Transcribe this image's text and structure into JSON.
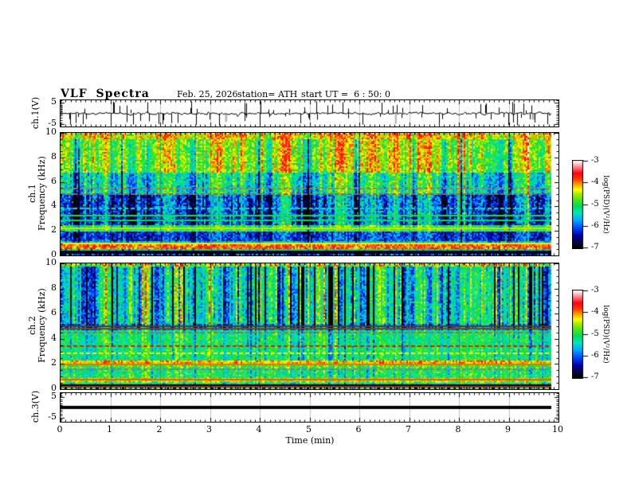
{
  "header": {
    "title": "VLF Spectra",
    "date": "Feb. 25, 2026",
    "station": "station= ATH",
    "start_ut": "start UT =  6 : 50: 0"
  },
  "chart_data": {
    "type": "heatmap",
    "description": "VLF receiver summary plot: ch.1 voltage waveform, ch.1 and ch.2 spectrograms (0-10 kHz, log PSD color coded), ch.3 flat voltage trace, versus time in minutes.",
    "xaxis": {
      "label": "Time (min)",
      "range": [
        0,
        10
      ],
      "ticks": [
        0,
        1,
        2,
        3,
        4,
        5,
        6,
        7,
        8,
        9,
        10
      ],
      "minor_step": 0.1,
      "data_end_min": 9.85
    },
    "colormap": {
      "range": [
        -7,
        -3
      ],
      "stops": [
        {
          "t": 0.0,
          "c": "#000000"
        },
        {
          "t": 0.06,
          "c": "#06063a"
        },
        {
          "t": 0.14,
          "c": "#0000aa"
        },
        {
          "t": 0.23,
          "c": "#0046ff"
        },
        {
          "t": 0.32,
          "c": "#00aaff"
        },
        {
          "t": 0.4,
          "c": "#00e6be"
        },
        {
          "t": 0.48,
          "c": "#00dc5a"
        },
        {
          "t": 0.55,
          "c": "#46e614"
        },
        {
          "t": 0.62,
          "c": "#aaeb00"
        },
        {
          "t": 0.67,
          "c": "#ffff00"
        },
        {
          "t": 0.73,
          "c": "#ffa000"
        },
        {
          "t": 0.79,
          "c": "#ff3c00"
        },
        {
          "t": 0.86,
          "c": "#ff0014"
        },
        {
          "t": 0.92,
          "c": "#ff6e78"
        },
        {
          "t": 0.97,
          "c": "#ffc8cd"
        },
        {
          "t": 1.0,
          "c": "#ffffff"
        }
      ]
    },
    "colorbars": [
      {
        "label": "log(PSD)(V²/Hz)",
        "ticks": [
          -3,
          -4,
          -5,
          -6,
          -7
        ]
      },
      {
        "label": "log(PSD)(V²/Hz)",
        "ticks": [
          -3,
          -4,
          -5,
          -6,
          -7
        ]
      }
    ],
    "panels": [
      {
        "id": "ch1_wave",
        "type": "line",
        "ylabel": "ch.1(V)",
        "ylim": [
          -6,
          6
        ],
        "yticks": [
          5,
          -5
        ],
        "y_minor_step": 1,
        "signal": {
          "seed": 11,
          "baseline": 0,
          "noise_amp": 0.4,
          "spikes": {
            "count": 85,
            "amp_min": 1.2,
            "amp_max": 5.6,
            "down_bias": 0.55
          },
          "gray_dips": 3
        }
      },
      {
        "id": "ch1_spec",
        "type": "heatmap",
        "ylabel_lines": [
          "ch.1",
          "Frequency (kHz)"
        ],
        "ylim": [
          0,
          10
        ],
        "yticks": [
          0,
          2,
          4,
          6,
          8,
          10
        ],
        "y_minor_step": 0.5,
        "seed": 42,
        "streaks": {
          "smooth": 0.78,
          "sigma": 0.5,
          "dark_p": 0.05,
          "dark_amp": 1.6,
          "bright_p": 0.1,
          "bright_amp": 0.9
        },
        "bands": [
          {
            "f": [
              9.5,
              10.01
            ],
            "base": -4.25,
            "var": 0.5,
            "streak": 0.5
          },
          {
            "f": [
              6.8,
              9.5
            ],
            "base": -4.65,
            "var": 0.5,
            "streak": 0.85
          },
          {
            "f": [
              5.0,
              6.8
            ],
            "base": -5.35,
            "var": 0.55,
            "streak": 0.95
          },
          {
            "f": [
              2.45,
              5.0
            ],
            "base": -6.1,
            "var": 0.6,
            "streak": 1.05
          },
          {
            "f": [
              2.0,
              2.45
            ],
            "base": -5.0,
            "var": 0.5,
            "streak": 0.55
          },
          {
            "f": [
              1.15,
              2.0
            ],
            "base": -6.2,
            "var": 0.5,
            "streak": 0.45
          },
          {
            "f": [
              0.95,
              1.15
            ],
            "base": -5.6,
            "var": 0.5,
            "streak": 0.3
          },
          {
            "f": [
              0.5,
              0.95
            ],
            "base": -3.85,
            "var": 0.5,
            "streak": 0.2
          },
          {
            "f": [
              0.35,
              0.5
            ],
            "base": -5.6,
            "var": 0.6,
            "streak": 0.2
          },
          {
            "f": [
              0.12,
              0.35
            ],
            "base": -6.85,
            "var": 0.3,
            "streak": 0.05
          },
          {
            "f": [
              0.0,
              0.12
            ],
            "base": -6.3,
            "var": 0.9,
            "streak": 0.05
          }
        ],
        "hlines": [
          {
            "f": 5.5,
            "color": "#8c7c6e",
            "dash": true
          },
          {
            "f": 5.05,
            "color": "#96604b",
            "dash": true
          },
          {
            "f": 3.9,
            "value": -5.4,
            "dash": true
          },
          {
            "f": 3.3,
            "value": -5.0,
            "dash": false
          },
          {
            "f": 2.9,
            "value": -5.05,
            "dash": false
          },
          {
            "f": 2.3,
            "value": -4.5,
            "dash": false
          },
          {
            "f": 2.1,
            "value": -4.7,
            "dash": true
          },
          {
            "f": 1.05,
            "value": -4.4,
            "dash": false
          },
          {
            "f": 0.5,
            "value": -4.9,
            "dash": true
          }
        ]
      },
      {
        "id": "ch2_spec",
        "type": "heatmap",
        "ylabel_lines": [
          "ch.2",
          "Frequency (kHz)"
        ],
        "ylim": [
          0,
          10
        ],
        "yticks": [
          0,
          2,
          4,
          6,
          8,
          10
        ],
        "y_minor_step": 0.5,
        "seed": 1337,
        "streaks": {
          "smooth": 0.72,
          "sigma": 0.5,
          "dark_p": 0.11,
          "dark_amp": 1.8,
          "bright_p": 0.14,
          "bright_amp": 1.0
        },
        "bands": [
          {
            "f": [
              9.7,
              10.01
            ],
            "base": -4.5,
            "var": 0.55,
            "streak": 0.7
          },
          {
            "f": [
              5.15,
              9.7
            ],
            "base": -5.5,
            "var": 0.5,
            "streak": 1.3
          },
          {
            "f": [
              4.7,
              5.15
            ],
            "base": -5.9,
            "var": 0.6,
            "streak": 0.8
          },
          {
            "f": [
              2.25,
              4.7
            ],
            "base": -5.15,
            "var": 0.45,
            "streak": 0.45
          },
          {
            "f": [
              1.95,
              2.25
            ],
            "base": -4.15,
            "var": 0.4,
            "streak": 0.3
          },
          {
            "f": [
              1.6,
              1.95
            ],
            "base": -4.85,
            "var": 0.45,
            "streak": 0.3
          },
          {
            "f": [
              0.9,
              1.6
            ],
            "base": -5.1,
            "var": 0.5,
            "streak": 0.35
          },
          {
            "f": [
              0.5,
              0.9
            ],
            "base": -4.55,
            "var": 0.5,
            "streak": 0.25
          },
          {
            "f": [
              0.32,
              0.5
            ],
            "base": -5.3,
            "var": 0.6,
            "streak": 0.2
          },
          {
            "f": [
              0.1,
              0.32
            ],
            "base": -6.9,
            "var": 0.25,
            "streak": 0.05
          },
          {
            "f": [
              0.0,
              0.1
            ],
            "base": -6.5,
            "var": 0.7,
            "streak": 0.05
          }
        ],
        "hlines": [
          {
            "f": 5.05,
            "color": "#553c24",
            "dash": false
          },
          {
            "f": 4.85,
            "color": "#6b4a2e",
            "dash": false
          },
          {
            "f": 4.55,
            "color": "#7a7a72",
            "dash": true
          },
          {
            "f": 3.5,
            "color": "#cc2800",
            "dash": true
          },
          {
            "f": 2.9,
            "value": -4.35,
            "dash": true
          },
          {
            "f": 2.05,
            "value": -3.95,
            "dash": false
          },
          {
            "f": 1.62,
            "color": "#82827a",
            "dash": true
          },
          {
            "f": 0.8,
            "value": -3.9,
            "dash": false
          },
          {
            "f": 0.28,
            "color": "#a03226",
            "dash": false
          },
          {
            "f": 0.15,
            "value": -4.7,
            "dash": true
          }
        ]
      },
      {
        "id": "ch3_wave",
        "type": "flatline",
        "ylabel": "ch.3(V)",
        "ylim": [
          -7,
          7
        ],
        "yticks": [
          5,
          -5
        ],
        "y_minor_step": 1,
        "value": 0,
        "thickness": 4
      }
    ]
  }
}
